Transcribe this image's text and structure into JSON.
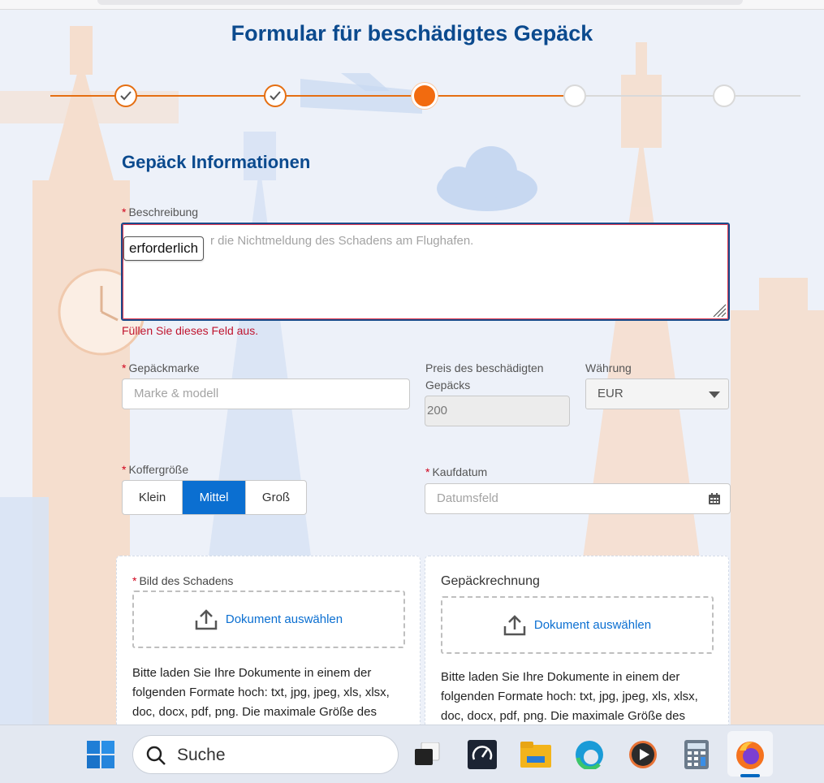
{
  "page": {
    "title": "Formular für beschädigtes Gepäck",
    "section_title": "Gepäck Informationen"
  },
  "stepper": {
    "steps": [
      {
        "state": "done"
      },
      {
        "state": "done"
      },
      {
        "state": "active"
      },
      {
        "state": "pending"
      },
      {
        "state": "pending"
      }
    ],
    "accent": "#f26b0f"
  },
  "description": {
    "required_mark": "*",
    "label": "Beschreibung",
    "placeholder_visible": "r die Nichtmeldung des Schadens am Flughafen.",
    "tooltip": "erforderlich",
    "error": "Füllen Sie dieses Feld aus."
  },
  "brand": {
    "required_mark": "*",
    "label": "Gepäckmarke",
    "placeholder": "Marke & modell"
  },
  "price": {
    "label_line1": "Preis des beschädigten",
    "label_line2": "Gepäcks",
    "value": "200"
  },
  "currency": {
    "label": "Währung",
    "value": "EUR"
  },
  "size": {
    "required_mark": "*",
    "label": "Koffergröße",
    "options": [
      "Klein",
      "Mittel",
      "Groß"
    ],
    "selected": "Mittel"
  },
  "purchase_date": {
    "required_mark": "*",
    "label": "Kaufdatum",
    "placeholder": "Datumsfeld"
  },
  "damage_image": {
    "required_mark": "*",
    "label": "Bild des Schadens",
    "button": "Dokument auswählen",
    "text_lines": [
      "Bitte laden Sie Ihre Dokumente in einem der",
      "folgenden Formate hoch: txt, jpg, jpeg, xls, xlsx,",
      "doc, docx, pdf, png. Die maximale Größe des"
    ]
  },
  "invoice": {
    "label": "Gepäckrechnung",
    "button": "Dokument auswählen",
    "text_lines": [
      "Bitte laden Sie Ihre Dokumente in einem der",
      "folgenden Formate hoch: txt, jpg, jpeg, xls, xlsx,",
      "doc, docx, pdf, png. Die maximale Größe des"
    ]
  },
  "taskbar": {
    "search_label": "Suche",
    "apps": [
      "windows-start-icon",
      "task-view-icon",
      "speedtest-icon",
      "file-explorer-icon",
      "edge-icon",
      "media-player-icon",
      "calculator-icon",
      "firefox-icon"
    ]
  },
  "colors": {
    "brand_blue": "#0b4a8e",
    "primary": "#0b6fd1",
    "error": "#c0152f"
  }
}
